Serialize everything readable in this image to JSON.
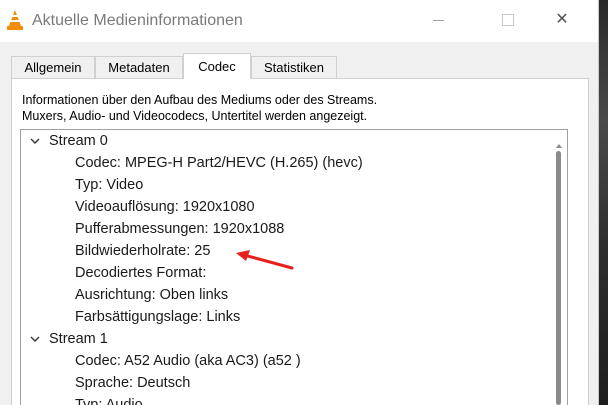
{
  "window": {
    "title": "Aktuelle Medieninformationen",
    "close_glyph": "✕",
    "app_icon": "vlc-cone-icon"
  },
  "tabs": [
    {
      "label": "Allgemein",
      "active": false
    },
    {
      "label": "Metadaten",
      "active": false
    },
    {
      "label": "Codec",
      "active": true
    },
    {
      "label": "Statistiken",
      "active": false
    }
  ],
  "codec": {
    "description_line1": "Informationen über den Aufbau des Mediums oder des Streams.",
    "description_line2": "Muxers, Audio- und Videocodecs, Untertitel werden angezeigt.",
    "streams": [
      {
        "label": "Stream 0",
        "expanded": true,
        "items": [
          "Codec: MPEG-H Part2/HEVC (H.265) (hevc)",
          "Typ: Video",
          "Videoauflösung: 1920x1080",
          "Pufferabmessungen: 1920x1088",
          "Bildwiederholrate: 25",
          "Decodiertes Format:",
          "Ausrichtung: Oben links",
          "Farbsättigungslage: Links"
        ]
      },
      {
        "label": "Stream 1",
        "expanded": true,
        "items": [
          "Codec: A52 Audio (aka AC3) (a52 )",
          "Sprache: Deutsch",
          "Typ: Audio"
        ]
      }
    ]
  },
  "annotation": {
    "color": "#e8201c",
    "icon": "red-arrow-annotation"
  },
  "colors": {
    "accent_vlc_orange": "#f28b00",
    "scrollbar": "#8a8a8a"
  }
}
